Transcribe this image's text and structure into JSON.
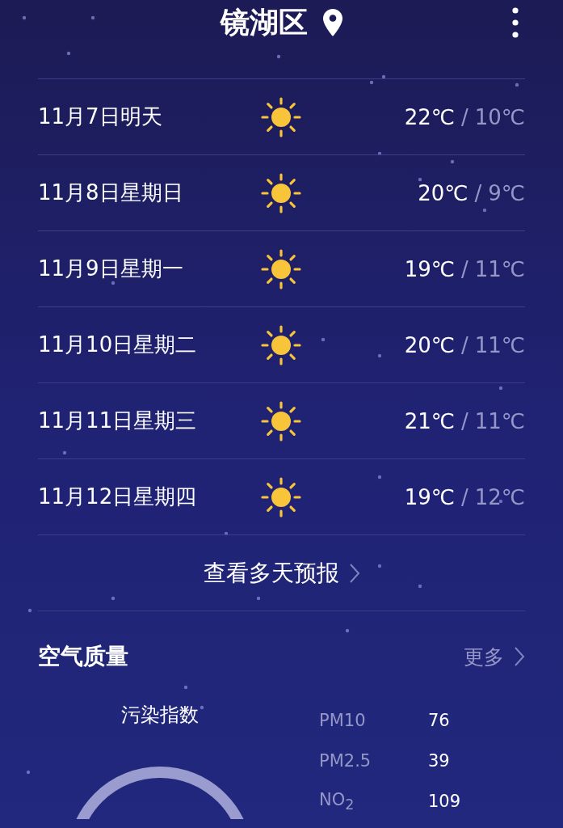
{
  "header": {
    "title": "镜湖区"
  },
  "forecast": [
    {
      "date": "11月7日明天",
      "high": "22℃",
      "separator": "/",
      "low": "10℃"
    },
    {
      "date": "11月8日星期日",
      "high": "20℃",
      "separator": "/",
      "low": "9℃"
    },
    {
      "date": "11月9日星期一",
      "high": "19℃",
      "separator": "/",
      "low": "11℃"
    },
    {
      "date": "11月10日星期二",
      "high": "20℃",
      "separator": "/",
      "low": "11℃"
    },
    {
      "date": "11月11日星期三",
      "high": "21℃",
      "separator": "/",
      "low": "11℃"
    },
    {
      "date": "11月12日星期四",
      "high": "19℃",
      "separator": "/",
      "low": "12℃"
    }
  ],
  "more_forecast": "查看多天预报",
  "air_quality": {
    "title": "空气质量",
    "more": "更多",
    "index_label": "污染指数",
    "pollutants": [
      {
        "name": "PM10",
        "value": "76"
      },
      {
        "name": "PM2.5",
        "value": "39"
      },
      {
        "name": "NO$_{2}$",
        "value": "109"
      }
    ]
  }
}
